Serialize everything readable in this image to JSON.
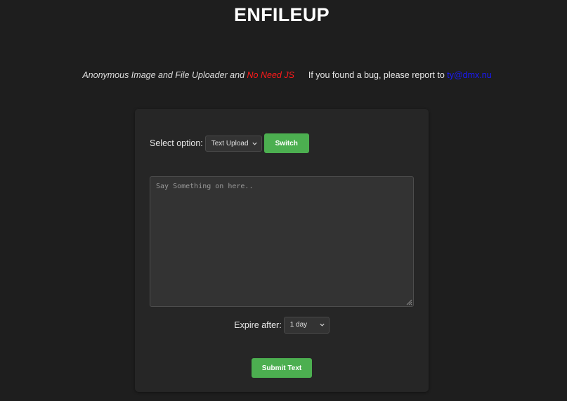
{
  "header": {
    "title": "ENFILEUP"
  },
  "tagline": {
    "description": "Anonymous Image and File Uploader and",
    "no_js": "No Need JS",
    "bug_text": "If you found a bug, please report to",
    "email": "ty@dmx.nu"
  },
  "form": {
    "option_label": "Select option:",
    "upload_type": {
      "selected": "Text Upload"
    },
    "switch_label": "Switch",
    "text_placeholder": "Say Something on here..",
    "text_value": "",
    "expire_label": "Expire after:",
    "expire": {
      "selected": "1 day"
    },
    "submit_label": "Submit Text"
  },
  "colors": {
    "background": "#1e1e1e",
    "panel": "#262626",
    "accent_green": "#4caf50",
    "no_js_red": "#ff1a1a",
    "email_link": "#1a1aff"
  },
  "icons": {
    "dropdown": "chevron-down-icon",
    "resize": "resize-grip-icon"
  }
}
